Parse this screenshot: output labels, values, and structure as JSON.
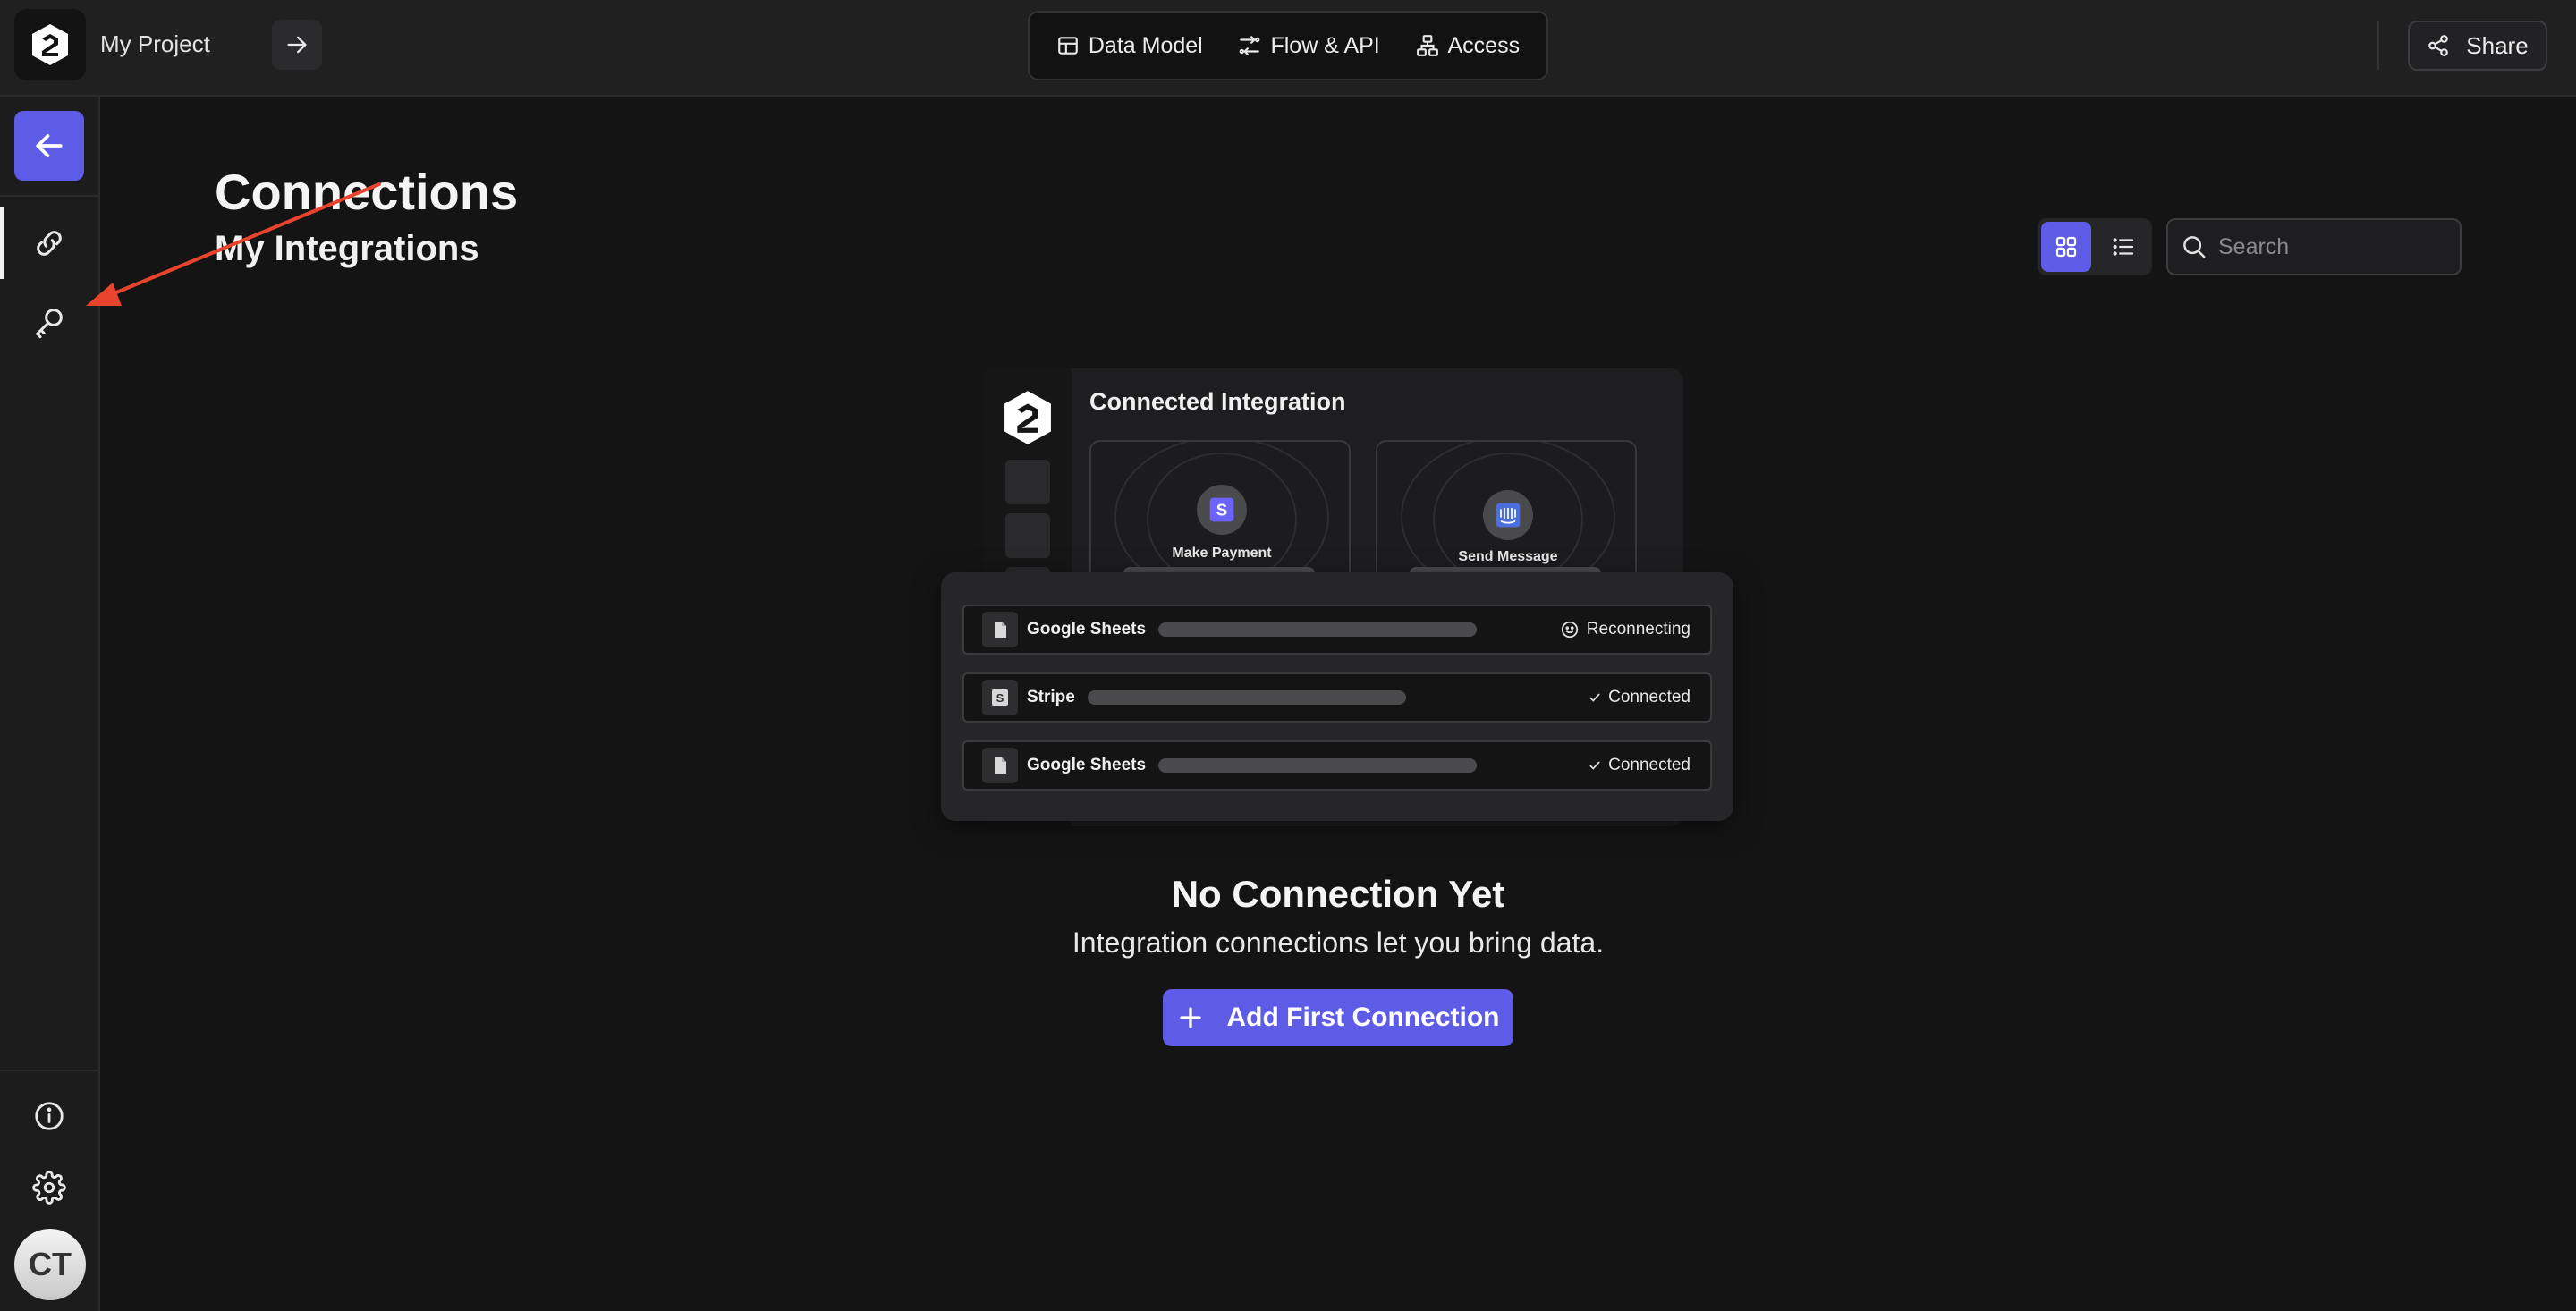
{
  "header": {
    "project_name": "My Project",
    "tabs": [
      {
        "label": "Data Model",
        "icon": "table-icon"
      },
      {
        "label": "Flow & API",
        "icon": "flow-icon"
      },
      {
        "label": "Access",
        "icon": "sitemap-icon"
      }
    ],
    "share_label": "Share"
  },
  "sidebar": {
    "items": [
      {
        "name": "connections",
        "icon": "link-icon",
        "active": true
      },
      {
        "name": "api-keys",
        "icon": "key-icon",
        "active": false
      }
    ],
    "bottom": [
      {
        "name": "info",
        "icon": "info-icon"
      },
      {
        "name": "settings",
        "icon": "gear-icon"
      }
    ],
    "avatar_initials": "CT"
  },
  "main": {
    "title": "Connections",
    "subtitle": "My Integrations",
    "search_placeholder": "Search",
    "view_mode": "grid"
  },
  "illustration": {
    "title": "Connected Integration",
    "cards": [
      {
        "label": "Make Payment",
        "icon": "stripe-icon"
      },
      {
        "label": "Send Message",
        "icon": "intercom-icon"
      }
    ],
    "rows": [
      {
        "name": "Google Sheets",
        "status": "Reconnecting",
        "icon": "document-icon"
      },
      {
        "name": "Stripe",
        "status": "Connected",
        "icon": "stripe-icon"
      },
      {
        "name": "Google Sheets",
        "status": "Connected",
        "icon": "document-icon"
      }
    ]
  },
  "empty_state": {
    "title": "No Connection Yet",
    "description": "Integration connections let you bring data.",
    "button_label": "Add First Connection"
  },
  "colors": {
    "accent": "#5e5ce6",
    "background": "#141414",
    "annotation_arrow": "#e8432d"
  }
}
